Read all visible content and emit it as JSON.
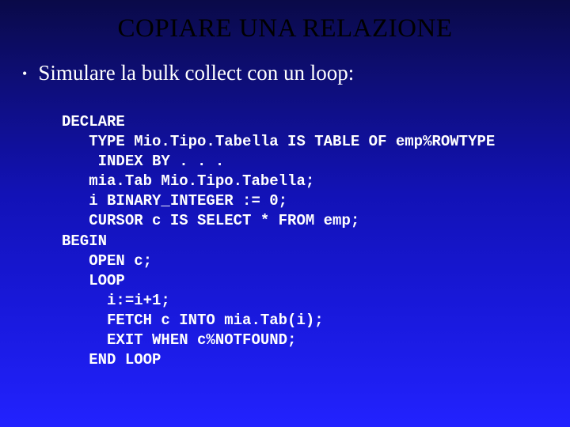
{
  "title": "COPIARE UNA RELAZIONE",
  "bullet": "Simulare la bulk collect con un loop:",
  "code": {
    "l01": "DECLARE",
    "l02": "   TYPE Mio.Tipo.Tabella IS TABLE OF emp%ROWTYPE",
    "l03": "    INDEX BY . . .",
    "l04": "   mia.Tab Mio.Tipo.Tabella;",
    "l05": "   i BINARY_INTEGER := 0;",
    "l06": "   CURSOR c IS SELECT * FROM emp;",
    "l07": "BEGIN",
    "l08": "   OPEN c;",
    "l09": "   LOOP",
    "l10": "     i:=i+1;",
    "l11": "     FETCH c INTO mia.Tab(i);",
    "l12": "     EXIT WHEN c%NOTFOUND;",
    "l13": "   END LOOP"
  }
}
